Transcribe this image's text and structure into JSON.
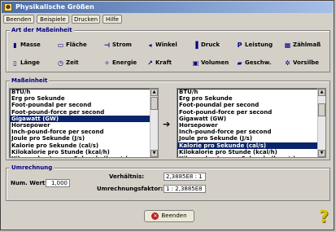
{
  "window": {
    "title": "Physikalische Größen"
  },
  "menu": [
    {
      "label": "Beenden"
    },
    {
      "label": "Beispiele"
    },
    {
      "label": "Drucken"
    },
    {
      "label": "Hilfe"
    }
  ],
  "unit_group": {
    "title": "Art der Maßeinheit",
    "units": [
      {
        "label": "Masse",
        "icon": "weight-icon"
      },
      {
        "label": "Fläche",
        "icon": "area-icon"
      },
      {
        "label": "Strom",
        "icon": "current-icon"
      },
      {
        "label": "Winkel",
        "icon": "angle-icon"
      },
      {
        "label": "Druck",
        "icon": "pressure-icon"
      },
      {
        "label": "Leistung",
        "icon": "power-icon"
      },
      {
        "label": "Zählmaß",
        "icon": "count-icon"
      },
      {
        "label": "Länge",
        "icon": "ruler-icon"
      },
      {
        "label": "Zeit",
        "icon": "clock-icon"
      },
      {
        "label": "Energie",
        "icon": "bulb-icon"
      },
      {
        "label": "Kraft",
        "icon": "force-icon"
      },
      {
        "label": "Volumen",
        "icon": "volume-icon"
      },
      {
        "label": "Geschw.",
        "icon": "speed-icon"
      },
      {
        "label": "Vorsilbe",
        "icon": "prefix-icon"
      }
    ]
  },
  "measure_group": {
    "title": "Maßeinheit",
    "list_items": [
      "BTU/h",
      "Erg pro Sekunde",
      "Foot-poundal per second",
      "Foot-pound-force per second",
      "Gigawatt (GW)",
      "Horsepower",
      "Inch-pound-force per second",
      "Joule pro Sekunde (J/s)",
      "Kalorie pro Sekunde (cal/s)",
      "Kilokalorie pro Stunde (kcal/h)",
      "Kilopondmeter pro Sekunde (kpm/s)"
    ],
    "left_selected": 4,
    "right_selected": 8,
    "arrow": "➔"
  },
  "conversion": {
    "title": "Umrechnung",
    "num_label": "Num. Wert:",
    "num_value": "1,000",
    "ratio_label": "Verhältnis:",
    "ratio_value": "2,3885E8 : 1",
    "factor_label": "Umrechnungsfaktor:",
    "factor_value": "1 : 2,3885E8"
  },
  "footer": {
    "exit_label": "Beenden",
    "help_glyph": "?"
  }
}
